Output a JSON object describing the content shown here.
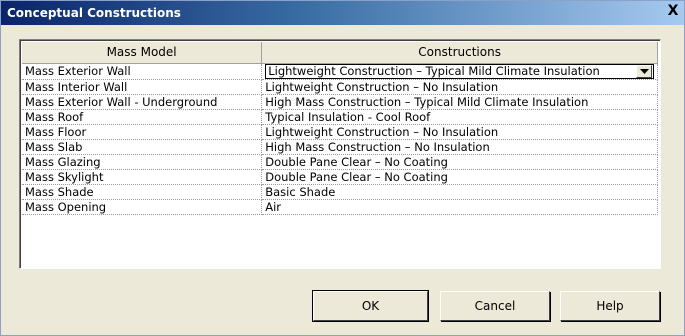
{
  "window": {
    "title": "Conceptual Constructions",
    "close_glyph": "X"
  },
  "grid": {
    "columns": [
      "Mass Model",
      "Constructions"
    ],
    "rows": [
      {
        "model": "Mass Exterior Wall",
        "construction": "Lightweight Construction – Typical Mild Climate Insulation",
        "selected": true
      },
      {
        "model": "Mass Interior Wall",
        "construction": "Lightweight Construction – No Insulation"
      },
      {
        "model": "Mass Exterior Wall - Underground",
        "construction": "High Mass Construction – Typical Mild Climate Insulation"
      },
      {
        "model": "Mass Roof",
        "construction": "Typical Insulation - Cool Roof"
      },
      {
        "model": "Mass Floor",
        "construction": "Lightweight Construction – No Insulation"
      },
      {
        "model": "Mass Slab",
        "construction": "High Mass Construction – No Insulation"
      },
      {
        "model": "Mass Glazing",
        "construction": "Double Pane Clear – No Coating"
      },
      {
        "model": "Mass Skylight",
        "construction": "Double Pane Clear – No Coating"
      },
      {
        "model": "Mass Shade",
        "construction": "Basic Shade"
      },
      {
        "model": "Mass Opening",
        "construction": "Air"
      }
    ]
  },
  "buttons": {
    "ok": "OK",
    "cancel": "Cancel",
    "help": "Help"
  },
  "colors": {
    "title_start": "#0a246a",
    "title_end": "#a6caf0",
    "dialog_bg": "#ece9d8"
  }
}
